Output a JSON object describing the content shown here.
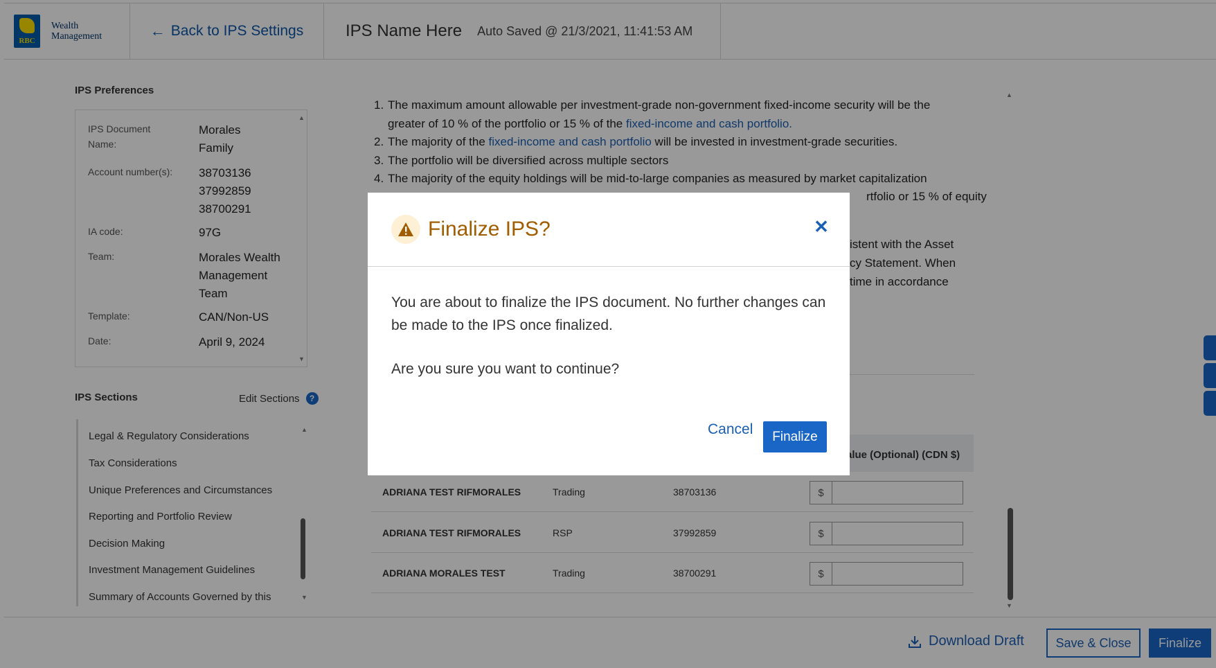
{
  "header": {
    "logo_brand": "RBC",
    "logo_text_line1": "Wealth",
    "logo_text_line2": "Management",
    "back_label": "Back to IPS Settings",
    "ips_name": "IPS Name Here",
    "autosave": "Auto Saved @ 21/3/2021, 11:41:53 AM"
  },
  "preferences": {
    "heading": "IPS Preferences",
    "doc_name_label_1": "IPS Document",
    "doc_name_label_2": "Name:",
    "doc_name_value_1": "Morales",
    "doc_name_value_2": "Family",
    "account_label": "Account number(s):",
    "accounts": [
      "38703136",
      "37992859",
      "38700291"
    ],
    "ia_label": "IA code:",
    "ia_value": "97G",
    "team_label": "Team:",
    "team_value_1": "Morales Wealth",
    "team_value_2": "Management",
    "team_value_3": "Team",
    "template_label": "Template:",
    "template_value": "CAN/Non-US",
    "date_label": "Date:",
    "date_value": "April 9, 2024"
  },
  "sections": {
    "heading": "IPS Sections",
    "edit_label": "Edit Sections",
    "help_glyph": "?",
    "items": [
      "Legal & Regulatory Considerations",
      "Tax Considerations",
      "Unique Preferences and Circumstances",
      "Reporting and Portfolio Review",
      "Decision Making",
      "Investment Management Guidelines",
      "Summary of Accounts Governed by this"
    ]
  },
  "document": {
    "item1_a": "The maximum amount allowable per investment-grade non-government fixed-income security will be the",
    "item1_b": "greater of 10 % of the portfolio or 15 % of the ",
    "item1_link": "fixed-income and cash portfolio.",
    "item2_a": "The majority of the ",
    "item2_link": "fixed-income and cash portfolio",
    "item2_b": " will be invested in investment-grade securities.",
    "item3": "The portfolio will be diversified across multiple sectors",
    "item4": "The majority of the equity holdings will be mid-to-large companies as measured by market capitalization",
    "frag5": "rtfolio or 15 % of equity",
    "frag6": "istent with the Asset",
    "frag7": "cy Statement. When",
    "frag8": "time in accordance",
    "col_header": "alue (Optional) (CDN $)",
    "currency_symbol": "$",
    "rows": [
      {
        "name": "ADRIANA TEST RIFMORALES",
        "type": "Trading",
        "account": "38703136"
      },
      {
        "name": "ADRIANA TEST RIFMORALES",
        "type": "RSP",
        "account": "37992859"
      },
      {
        "name": "ADRIANA MORALES TEST",
        "type": "Trading",
        "account": "38700291"
      }
    ]
  },
  "footer": {
    "download_label": "Download Draft",
    "save_close_label": "Save & Close",
    "finalize_label": "Finalize"
  },
  "modal": {
    "title": "Finalize IPS?",
    "close_glyph": "✕",
    "body": "You are about to finalize the IPS document. No further changes can be made to the IPS once finalized.",
    "question": "Are you sure you want to continue?",
    "cancel_label": "Cancel",
    "finalize_label": "Finalize"
  }
}
